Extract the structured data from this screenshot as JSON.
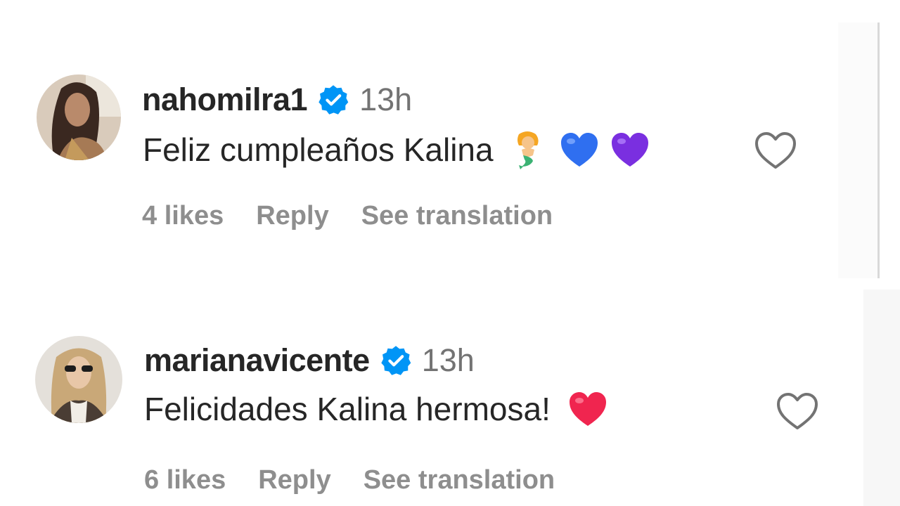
{
  "comments": [
    {
      "username": "nahomilra1",
      "verified": true,
      "time": "13h",
      "text": "Feliz cumpleaños Kalina",
      "emojis": [
        "mermaid-emoji",
        "blue-heart-emoji",
        "purple-heart-emoji"
      ],
      "likes": "4 likes",
      "reply": "Reply",
      "translate": "See translation"
    },
    {
      "username": "marianavicente",
      "verified": true,
      "time": "13h",
      "text": "Felicidades Kalina hermosa!",
      "emojis": [
        "red-heart-emoji"
      ],
      "likes": "6 likes",
      "reply": "Reply",
      "translate": "See translation"
    }
  ],
  "colors": {
    "verified": "#0095f6",
    "muted": "#8e8e8e",
    "text": "#262626"
  }
}
